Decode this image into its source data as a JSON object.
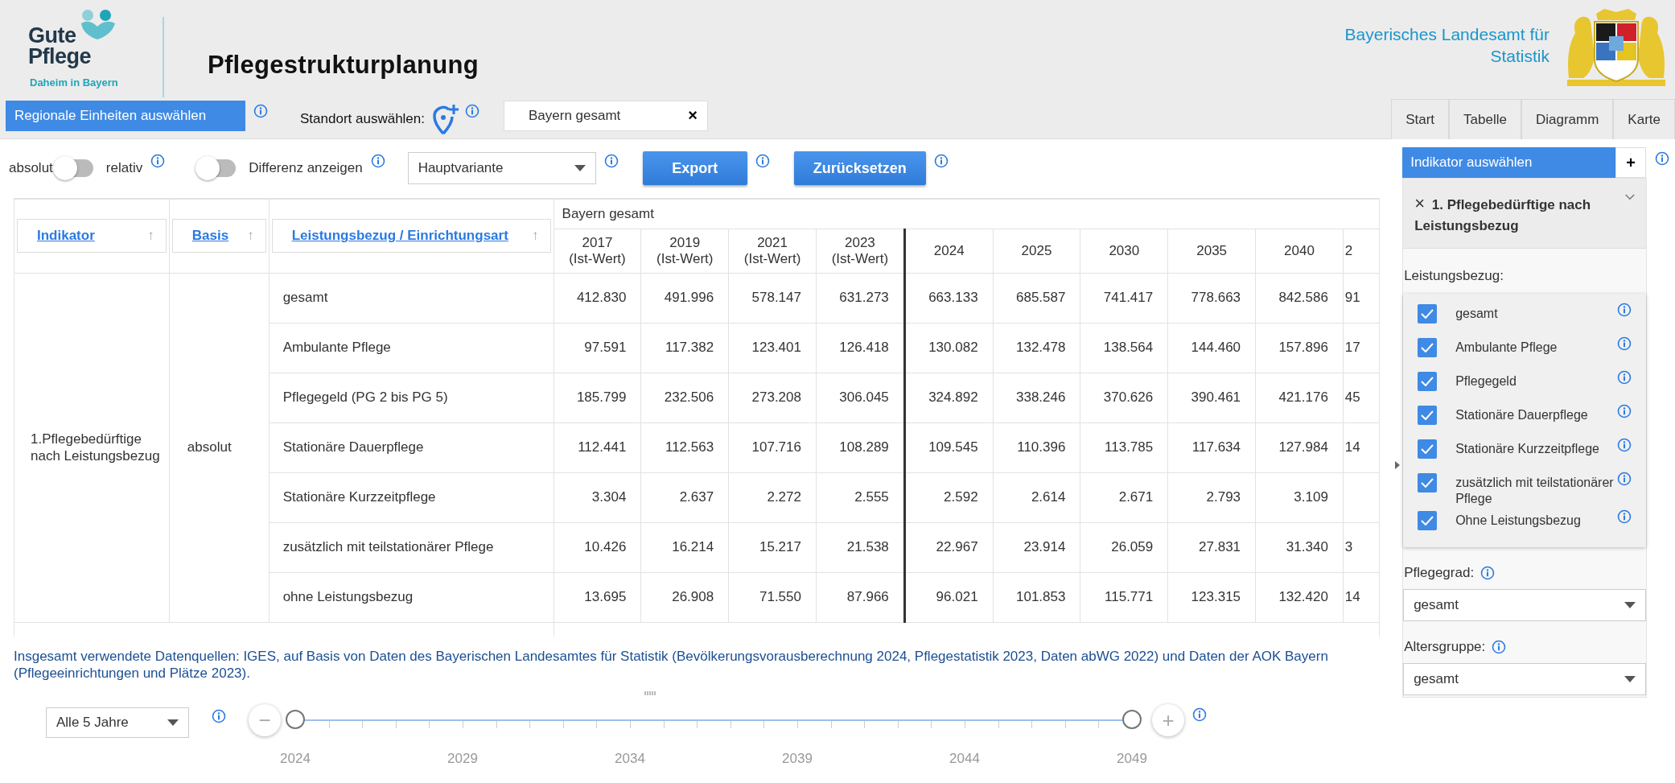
{
  "header": {
    "logo": {
      "line_1": "Gute",
      "line_2": "Pflege",
      "tagline": "Daheim in Bayern"
    },
    "title": "Pflegestrukturplanung",
    "agency": "Bayerisches Landesamt für Statistik"
  },
  "region_button": "Regionale Einheiten auswählen",
  "location": {
    "label": "Standort auswählen:",
    "value": "Bayern gesamt",
    "clear": "×"
  },
  "nav_tabs": [
    {
      "label": "Start",
      "selected": false
    },
    {
      "label": "Tabelle",
      "selected": false
    },
    {
      "label": "Diagramm",
      "selected": false
    },
    {
      "label": "Karte",
      "selected": false
    }
  ],
  "controls": {
    "toggle_left": "absolut",
    "toggle_right": "relativ",
    "relative_on": false,
    "difference_label": "Differenz anzeigen",
    "difference_on": false,
    "variant": "Hauptvariante",
    "export": "Export",
    "reset": "Zurücksetzen"
  },
  "table": {
    "columns": [
      {
        "label": "Indikator",
        "sort": "↑"
      },
      {
        "label": "Basis",
        "sort": "↑"
      },
      {
        "label": "Leistungsbezug / Einrichtungsart",
        "sort": "↑"
      }
    ],
    "group": "Bayern gesamt",
    "years": [
      {
        "year": "2017",
        "note": "(Ist-Wert)"
      },
      {
        "year": "2019",
        "note": "(Ist-Wert)"
      },
      {
        "year": "2021",
        "note": "(Ist-Wert)"
      },
      {
        "year": "2023",
        "note": "(Ist-Wert)"
      },
      {
        "year": "2024"
      },
      {
        "year": "2025"
      },
      {
        "year": "2030"
      },
      {
        "year": "2035"
      },
      {
        "year": "2040"
      },
      {
        "year": "2"
      }
    ],
    "indicator": "1.Pflegebedürftige nach Leistungsbezug",
    "basis": "absolut",
    "rows": [
      {
        "label": "gesamt",
        "cells": [
          "412.830",
          "491.996",
          "578.147",
          "631.273",
          "663.133",
          "685.587",
          "741.417",
          "778.663",
          "842.586",
          "91"
        ]
      },
      {
        "label": "Ambulante Pflege",
        "cells": [
          "97.591",
          "117.382",
          "123.401",
          "126.418",
          "130.082",
          "132.478",
          "138.564",
          "144.460",
          "157.896",
          "17"
        ]
      },
      {
        "label": "Pflegegeld (PG 2 bis PG 5)",
        "cells": [
          "185.799",
          "232.506",
          "273.208",
          "306.045",
          "324.892",
          "338.246",
          "370.626",
          "390.461",
          "421.176",
          "45"
        ]
      },
      {
        "label": "Stationäre Dauerpflege",
        "cells": [
          "112.441",
          "112.563",
          "107.716",
          "108.289",
          "109.545",
          "110.396",
          "113.785",
          "117.634",
          "127.984",
          "14"
        ]
      },
      {
        "label": "Stationäre Kurzzeitpflege",
        "cells": [
          "3.304",
          "2.637",
          "2.272",
          "2.555",
          "2.592",
          "2.614",
          "2.671",
          "2.793",
          "3.109"
        ]
      },
      {
        "label": "zusätzlich mit teilstationärer Pflege",
        "cells": [
          "10.426",
          "16.214",
          "15.217",
          "21.538",
          "22.967",
          "23.914",
          "26.059",
          "27.831",
          "31.340",
          "3"
        ]
      },
      {
        "label": "ohne Leistungsbezug",
        "cells": [
          "13.695",
          "26.908",
          "71.550",
          "87.966",
          "96.021",
          "101.853",
          "115.771",
          "123.315",
          "132.420",
          "14"
        ]
      }
    ]
  },
  "sources": "Insgesamt verwendete Datenquellen: IGES, auf Basis von Daten des Bayerischen Landesamtes für Statistik (Bevölkerungsvorausberechnung 2024, Pflegestatistik 2023, Daten abWG 2022) und Daten der AOK Bayern (Pflegeeinrichtungen und Plätze 2023).",
  "timeline": {
    "interval": "Alle 5 Jahre",
    "minus": "−",
    "plus": "+",
    "labels": [
      "2024",
      "2029",
      "2034",
      "2039",
      "2044",
      "2049"
    ],
    "thumbs": [
      {
        "level": 0
      },
      {
        "level": 1
      }
    ]
  },
  "panel": {
    "title": "Indikator auswählen",
    "add": "+",
    "indicator": {
      "remove": "×",
      "title": "1. Pflegebedürftige nach Leistungsbezug",
      "expanded": true
    },
    "group_label": "Leistungsbezug:",
    "options": [
      {
        "label": "gesamt",
        "checked": true
      },
      {
        "label": "Ambulante Pflege",
        "checked": true
      },
      {
        "label": "Pflegegeld",
        "checked": true
      },
      {
        "label": "Stationäre Dauerpflege",
        "checked": true
      },
      {
        "label": "Stationäre Kurzzeitpflege",
        "checked": true
      },
      {
        "label": "zusätzlich mit teilstationärer Pflege",
        "checked": true
      },
      {
        "label": "Ohne Leistungsbezug",
        "checked": true
      }
    ],
    "care_level": {
      "label": "Pflegegrad:",
      "value": "gesamt"
    },
    "age_group": {
      "label": "Altersgruppe:",
      "value": "gesamt"
    }
  }
}
